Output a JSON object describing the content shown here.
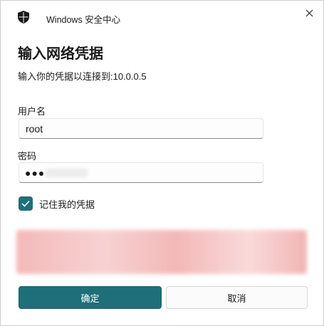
{
  "window": {
    "app_title": "Windows 安全中心",
    "app_icon": "shield-icon",
    "close_icon": "close-icon"
  },
  "dialog": {
    "heading": "输入网络凭据",
    "subtitle": "输入你的凭据以连接到:10.0.0.5"
  },
  "form": {
    "username_label": "用户名",
    "username_value": "root",
    "password_label": "密码",
    "password_masked": "●●●",
    "remember_label": "记住我的凭据",
    "remember_checked": true
  },
  "buttons": {
    "ok_label": "确定",
    "cancel_label": "取消"
  },
  "colors": {
    "accent": "#1f6f7a",
    "redacted": "#f4b9b9"
  }
}
